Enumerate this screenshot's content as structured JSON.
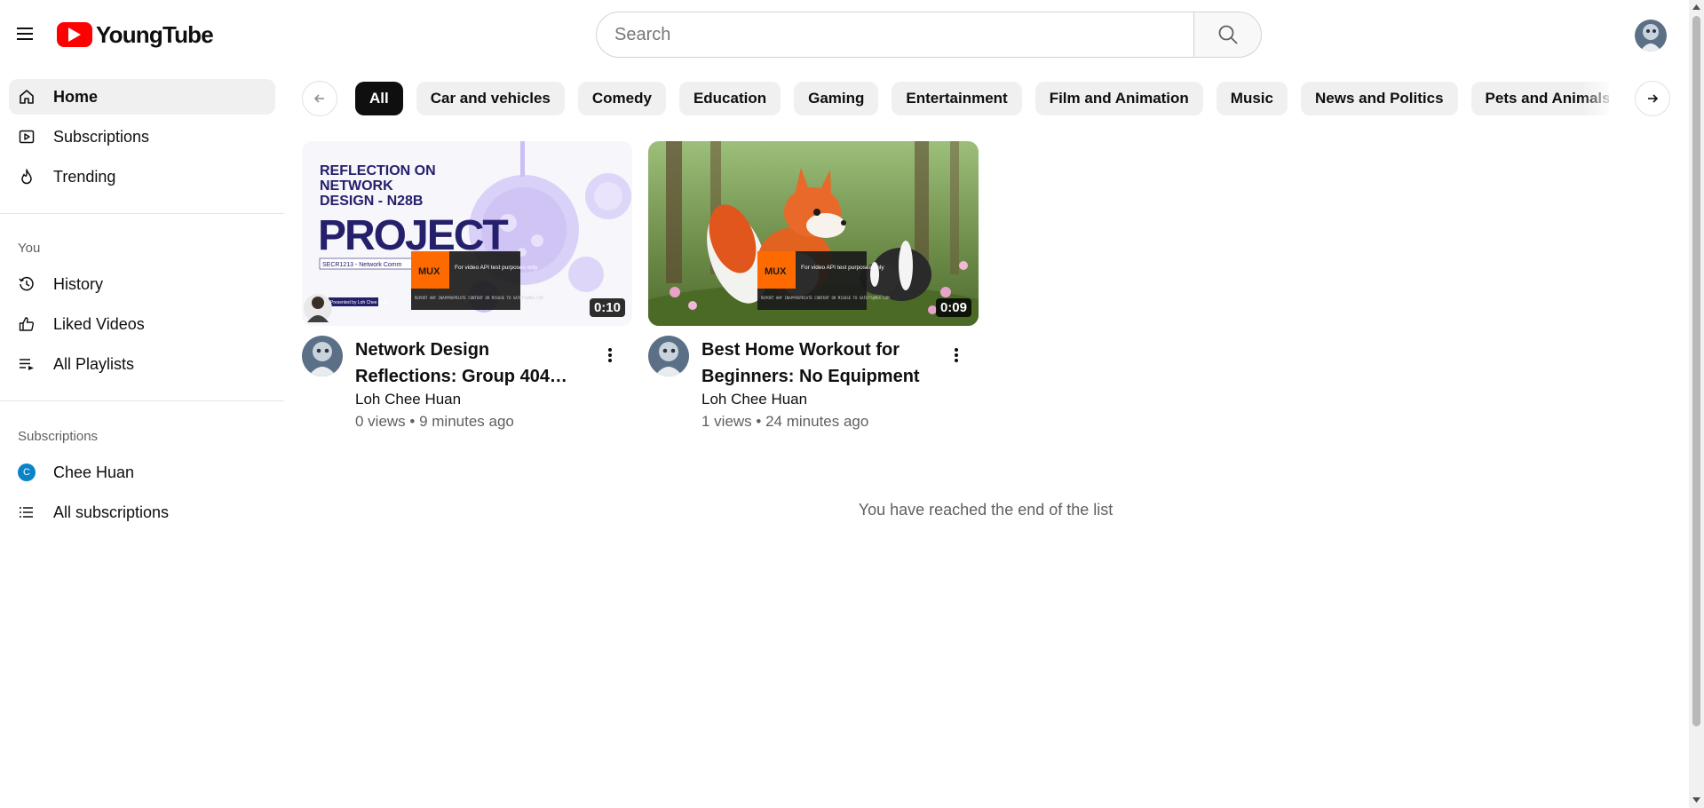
{
  "app": {
    "brand": "YoungTube",
    "accent_color": "#ff0000"
  },
  "search": {
    "placeholder": "Search",
    "value": ""
  },
  "sidebar": {
    "main_items": [
      {
        "label": "Home",
        "icon": "home-icon",
        "active": true
      },
      {
        "label": "Subscriptions",
        "icon": "subscriptions-icon"
      },
      {
        "label": "Trending",
        "icon": "trending-icon"
      }
    ],
    "you_heading": "You",
    "you_items": [
      {
        "label": "History",
        "icon": "history-icon"
      },
      {
        "label": "Liked Videos",
        "icon": "thumbs-up-icon"
      },
      {
        "label": "All Playlists",
        "icon": "playlist-icon"
      }
    ],
    "subs_heading": "Subscriptions",
    "subs_items": [
      {
        "label": "Chee Huan",
        "icon": "channel-avatar",
        "avatar_letter": "C",
        "avatar_color": "#0a84c9"
      },
      {
        "label": "All subscriptions",
        "icon": "list-icon"
      }
    ]
  },
  "chips": [
    "All",
    "Car and vehicles",
    "Comedy",
    "Education",
    "Gaming",
    "Entertainment",
    "Film and Animation",
    "Music",
    "News and Politics",
    "Pets and Animals"
  ],
  "active_chip": "All",
  "videos": [
    {
      "title": "Network Design Reflections: Group 404…",
      "channel": "Loh Chee Huan",
      "meta": "0 views • 9 minutes ago",
      "duration": "0:10",
      "thumb": {
        "heading_line1": "REFLECTION ON",
        "heading_line2": "NETWORK",
        "heading_line3": "DESIGN - N28B",
        "big_word": "PROJECT",
        "subtitle": "SECR1213 - Network Comm",
        "presenter": "Presented by Loh Chee Huan",
        "watermark_brand": "MUX",
        "watermark_text": "For video API test purposes only",
        "watermark_small": "REPORT ANY INAPPROPRIATE CONTENT OR MISUSE TO SAFETY@MUX.COM"
      }
    },
    {
      "title": "Best Home Workout for Beginners: No Equipment",
      "channel": "Loh Chee Huan",
      "meta": "1 views • 24 minutes ago",
      "duration": "0:09",
      "thumb": {
        "watermark_brand": "MUX",
        "watermark_text": "For video API test purposes only",
        "watermark_small": "REPORT ANY INAPPROPRIATE CONTENT OR MISUSE TO SAFETY@MUX.COM"
      }
    }
  ],
  "end_message": "You have reached the end of the list"
}
